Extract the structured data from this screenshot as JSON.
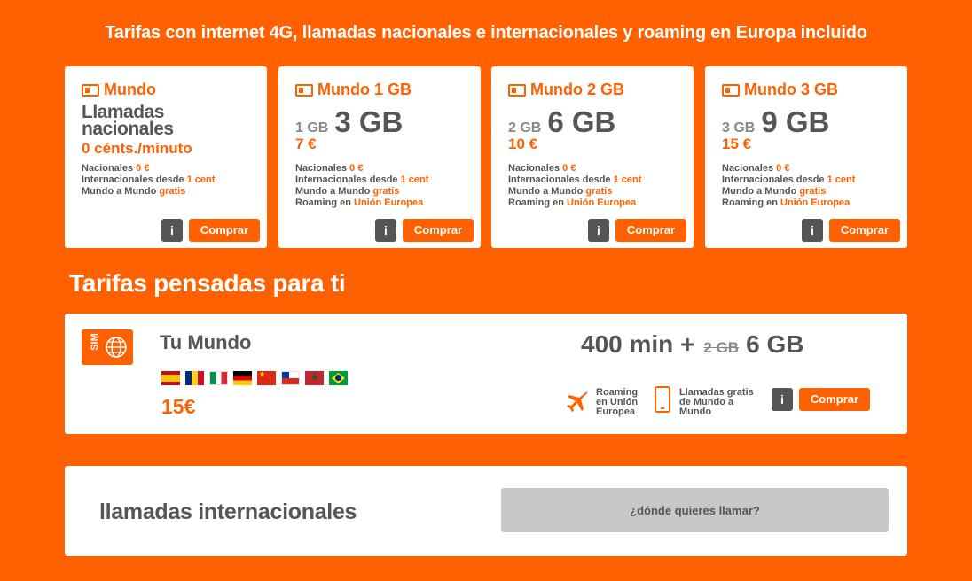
{
  "headline": "Tarifas con internet 4G, llamadas nacionales e internacionales y roaming en Europa incluido",
  "cards": [
    {
      "title": "Mundo",
      "line1": "Llamadas",
      "line2": "nacionales",
      "cents": "0 cénts./minuto",
      "features": [
        {
          "label": "Nacionales ",
          "value": "0 €"
        },
        {
          "label": "Internacionales desde ",
          "value": "1 cent"
        },
        {
          "label": "Mundo a Mundo ",
          "value": "gratis"
        }
      ],
      "info": "i",
      "buy": "Comprar"
    },
    {
      "title": "Mundo 1 GB",
      "old": "1 GB",
      "new": "3 GB",
      "price": "7 €",
      "features": [
        {
          "label": "Nacionales ",
          "value": "0 €"
        },
        {
          "label": "Internacionales desde ",
          "value": "1 cent"
        },
        {
          "label": "Mundo a Mundo ",
          "value": "gratis"
        },
        {
          "label": "Roaming en ",
          "value": "Unión Europea"
        }
      ],
      "info": "i",
      "buy": "Comprar"
    },
    {
      "title": "Mundo 2 GB",
      "old": "2 GB",
      "new": "6 GB",
      "price": "10 €",
      "features": [
        {
          "label": "Nacionales ",
          "value": "0 €"
        },
        {
          "label": "Internacionales desde ",
          "value": "1 cent"
        },
        {
          "label": "Mundo a Mundo ",
          "value": "gratis"
        },
        {
          "label": "Roaming en ",
          "value": "Unión Europea"
        }
      ],
      "info": "i",
      "buy": "Comprar"
    },
    {
      "title": "Mundo 3 GB",
      "old": "3 GB",
      "new": "9 GB",
      "price": "15 €",
      "features": [
        {
          "label": "Nacionales ",
          "value": "0 €"
        },
        {
          "label": "Internacionales desde ",
          "value": "1 cent"
        },
        {
          "label": "Mundo a Mundo ",
          "value": "gratis"
        },
        {
          "label": "Roaming en ",
          "value": "Unión Europea"
        }
      ],
      "info": "i",
      "buy": "Comprar"
    }
  ],
  "section_title": "Tarifas pensadas para ti",
  "tu_mundo": {
    "sim_label": "SIM",
    "name": "Tu Mundo",
    "flags": [
      "spain-flag",
      "romania-flag",
      "italy-flag",
      "germany-flag",
      "china-flag",
      "chile-flag",
      "morocco-flag",
      "brazil-flag"
    ],
    "price": "15€",
    "mins": "400 min +",
    "old": "2 GB",
    "new": "6 GB",
    "roaming_l1": "Roaming",
    "roaming_l2": "en Unión",
    "roaming_l3": "Europea",
    "calls_l1": "Llamadas gratis",
    "calls_l2": "de Mundo a",
    "calls_l3": "Mundo",
    "info": "i",
    "buy": "Comprar"
  },
  "intl": {
    "label": "llamadas internacionales",
    "placeholder": "¿dónde quieres llamar?"
  },
  "colors": {
    "accent": "#ff6000",
    "text": "#555555",
    "input_bg": "#c8c8c8"
  }
}
